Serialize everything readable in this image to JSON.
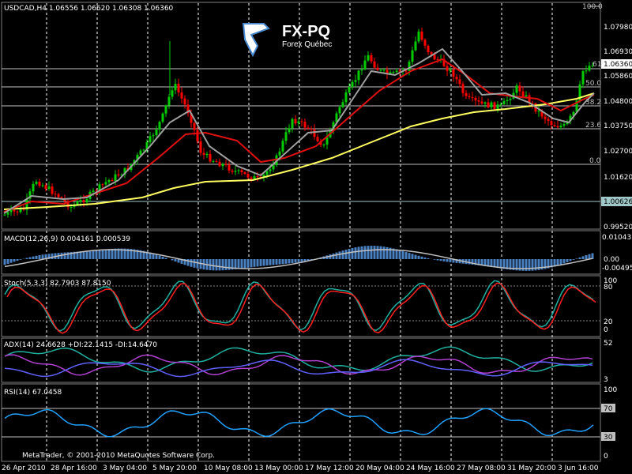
{
  "main": {
    "symbol_info": "USDCAD,H4  1.06556 1.06620 1.06308 1.06360",
    "logo_title": "FX-PQ",
    "logo_subtitle": "Forex Québec",
    "price_scale": [
      "1.07980",
      "1.06930",
      "1.05860",
      "1.04800",
      "1.03750",
      "1.02700",
      "1.01620",
      "0.99520"
    ],
    "current_price_label": "1.06360",
    "level_price_label": "1.00626",
    "fib_top_label": "100.0",
    "fib_levels": [
      "61.8",
      "50.0",
      "38.2",
      "23.6",
      "0.0"
    ],
    "colors": {
      "bull": "#00cc00",
      "bear": "#ff0000",
      "ma_fast": "#a0a0a0",
      "ma_mid": "#e01010",
      "ma_slow": "#ffff60",
      "grid": "#ffffff",
      "fib": "#c0c0c0"
    }
  },
  "macd": {
    "label": "MACD(12,26,9) 0.004161 0.000539",
    "scale": [
      "0.010431",
      "0.00",
      "-0.00495"
    ],
    "colors": {
      "hist": "#4a7fc0",
      "signal": "#c0c0c0"
    }
  },
  "stoch": {
    "label": "Stoch(5,3,3) 82.7903 87.8150",
    "scale": [
      "100",
      "80",
      "20",
      "0"
    ],
    "colors": {
      "main": "#20b0a0",
      "signal": "#ff2020"
    }
  },
  "adx": {
    "label": "ADX(14) 24.6628 +DI:22.1415 -DI:14.6470",
    "scale": [
      "52",
      "3"
    ],
    "colors": {
      "adx": "#20b0a0",
      "plus_di": "#b040d0",
      "minus_di": "#6060ff"
    }
  },
  "rsi": {
    "label": "RSI(14) 67.0458",
    "scale": [
      "100",
      "70",
      "30",
      "0"
    ],
    "colors": {
      "line": "#20a0ff"
    }
  },
  "copyright": "MetaTrader, © 2001-2010 MetaQuotes Software Corp.",
  "time_axis": [
    "26 Apr 2010",
    "28 Apr 16:00",
    "3 May 04:00",
    "5 May 20:00",
    "10 May 08:00",
    "13 May 00:00",
    "17 May 12:00",
    "20 May 04:00",
    "24 May 16:00",
    "27 May 08:00",
    "31 May 20:00",
    "3 Jun 16:00"
  ]
}
